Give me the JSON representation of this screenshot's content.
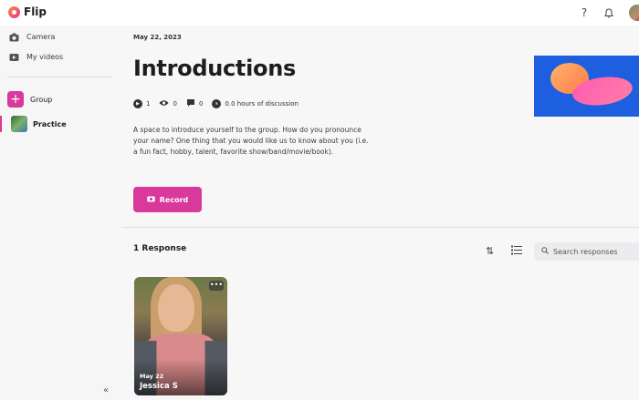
{
  "app": {
    "name": "Flip"
  },
  "topbar": {
    "help_icon": "question-icon",
    "bell_icon": "bell-icon"
  },
  "sidebar": {
    "items": [
      {
        "label": "Camera",
        "icon": "camera-icon"
      },
      {
        "label": "My videos",
        "icon": "video-icon"
      }
    ],
    "group_label": "Group",
    "practice_label": "Practice"
  },
  "topic": {
    "date": "May 22, 2023",
    "title": "Introductions",
    "stats": {
      "videos": "1",
      "views": "0",
      "comments": "0",
      "discussion": "0.0 hours of discussion"
    },
    "description": "A space to introduce yourself to the group. How do you pronounce your name? One thing that you would like us to know about you (i.e. a fun fact, hobby, talent, favorite show/band/movie/book).",
    "record_label": "Record"
  },
  "responses": {
    "count_label": "1 Response",
    "search_placeholder": "Search responses",
    "items": [
      {
        "date": "May 22",
        "name": "Jessica S"
      }
    ]
  },
  "colors": {
    "accent": "#d8399a",
    "banner": "#1e5fe0"
  }
}
